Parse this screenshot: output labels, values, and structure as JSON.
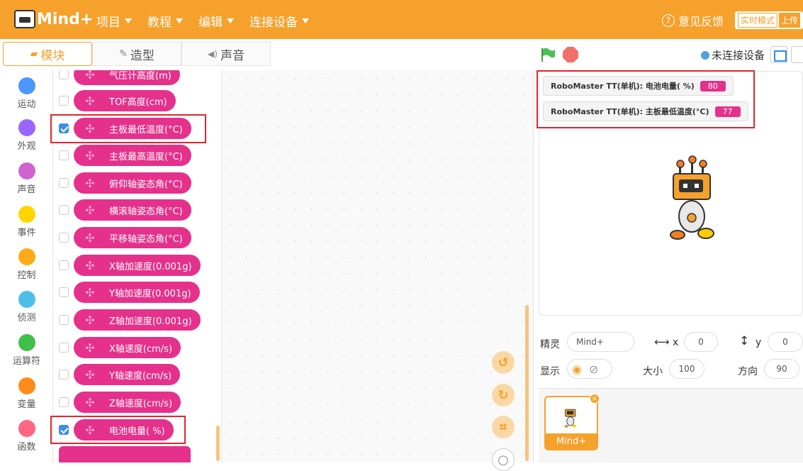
{
  "app": {
    "logo_text": "Mind+"
  },
  "menu": [
    {
      "label": "项目"
    },
    {
      "label": "教程"
    },
    {
      "label": "编辑"
    },
    {
      "label": "连接设备"
    }
  ],
  "topbar": {
    "feedback": "意见反馈",
    "mode_realtime": "实时模式",
    "mode_upload": "上传"
  },
  "tabs": {
    "blocks": "模块",
    "costumes": "造型",
    "sounds": "声音"
  },
  "categories": [
    {
      "label": "运动",
      "color": "#4c97ff"
    },
    {
      "label": "外观",
      "color": "#9966ff"
    },
    {
      "label": "声音",
      "color": "#cf63cf"
    },
    {
      "label": "事件",
      "color": "#ffd500"
    },
    {
      "label": "控制",
      "color": "#ffab19"
    },
    {
      "label": "侦测",
      "color": "#4cbfe6"
    },
    {
      "label": "运算符",
      "color": "#40bf4a"
    },
    {
      "label": "变量",
      "color": "#ff8c1a"
    },
    {
      "label": "函数",
      "color": "#ff6680"
    }
  ],
  "blocks": [
    {
      "label": "气压计高度(m)",
      "checked": false
    },
    {
      "label": "TOF高度(cm)",
      "checked": false
    },
    {
      "label": "主板最低温度(°C)",
      "checked": true
    },
    {
      "label": "主板最高温度(°C)",
      "checked": false
    },
    {
      "label": "俯仰轴姿态角(°C)",
      "checked": false
    },
    {
      "label": "横滚轴姿态角(°C)",
      "checked": false
    },
    {
      "label": "平移轴姿态角(°C)",
      "checked": false
    },
    {
      "label": "X轴加速度(0.001g)",
      "checked": false
    },
    {
      "label": "Y轴加速度(0.001g)",
      "checked": false
    },
    {
      "label": "Z轴加速度(0.001g)",
      "checked": false
    },
    {
      "label": "X轴速度(cm/s)",
      "checked": false
    },
    {
      "label": "Y轴速度(cm/s)",
      "checked": false
    },
    {
      "label": "Z轴速度(cm/s)",
      "checked": false
    },
    {
      "label": "电池电量( %)",
      "checked": true
    }
  ],
  "stage": {
    "connection_status": "未连接设备",
    "monitors": [
      {
        "label": "RoboMaster TT(单机): 电池电量( %)",
        "value": "80"
      },
      {
        "label": "RoboMaster TT(单机): 主板最低温度(°C)",
        "value": "77"
      }
    ]
  },
  "sprite": {
    "sprite_label": "精灵",
    "name": "Mind+",
    "x_label": "x",
    "x": "0",
    "y_label": "y",
    "y": "0",
    "show_label": "显示",
    "size_label": "大小",
    "size": "100",
    "direction_label": "方向",
    "direction": "90"
  },
  "sprite_list": [
    {
      "name": "Mind+"
    }
  ]
}
